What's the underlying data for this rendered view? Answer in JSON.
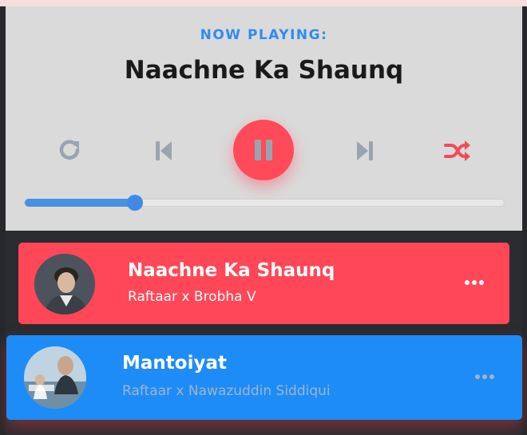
{
  "player": {
    "header_label": "NOW PLAYING:",
    "song_title": "Naachne Ka Shaunq",
    "progress_fraction": 0.23,
    "controls": {
      "repeat_icon": "repeat-icon",
      "prev_icon": "skip-back-icon",
      "play_state_icon": "pause-icon",
      "next_icon": "skip-forward-icon",
      "shuffle_icon": "shuffle-icon"
    }
  },
  "playlist": {
    "items": [
      {
        "title": "Naachne Ka Shaunq",
        "artist": "Raftaar x Brobha V",
        "state": "active"
      },
      {
        "title": "Mantoiyat",
        "artist": "Raftaar x Nawazuddin Siddiqui",
        "state": "hover"
      }
    ]
  },
  "colors": {
    "accent_red": "#ff4757",
    "accent_blue": "#1e8cf7",
    "label_blue": "#2f8cf0",
    "player_bg": "#dadada"
  }
}
